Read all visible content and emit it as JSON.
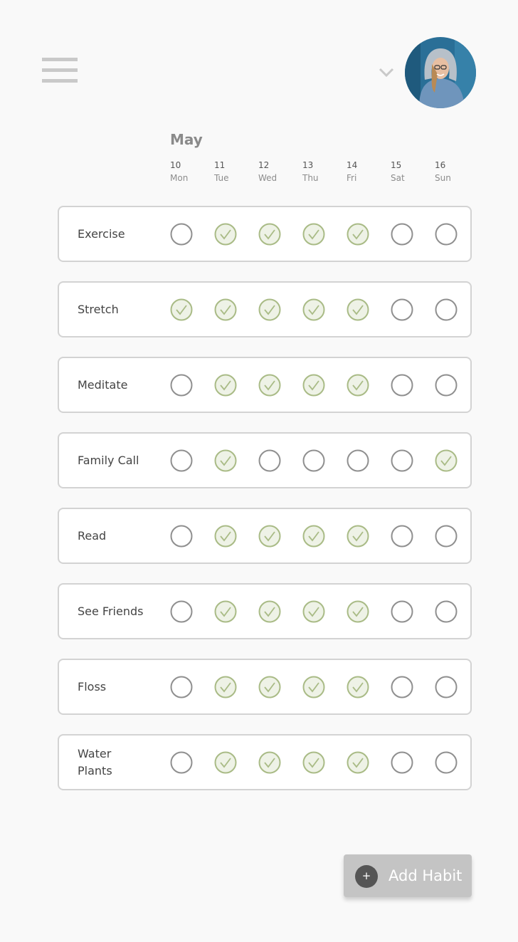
{
  "header": {
    "menu_icon": "hamburger-menu-icon",
    "dropdown_icon": "chevron-down-icon",
    "avatar_icon": "user-avatar"
  },
  "calendar": {
    "month": "May",
    "days": [
      {
        "num": "10",
        "dow": "Mon"
      },
      {
        "num": "11",
        "dow": "Tue"
      },
      {
        "num": "12",
        "dow": "Wed"
      },
      {
        "num": "13",
        "dow": "Thu"
      },
      {
        "num": "14",
        "dow": "Fri"
      },
      {
        "num": "15",
        "dow": "Sat"
      },
      {
        "num": "16",
        "dow": "Sun"
      }
    ]
  },
  "habits": [
    {
      "name": "Exercise",
      "done": [
        false,
        true,
        true,
        true,
        true,
        false,
        false
      ]
    },
    {
      "name": "Stretch",
      "done": [
        true,
        true,
        true,
        true,
        true,
        false,
        false
      ]
    },
    {
      "name": "Meditate",
      "done": [
        false,
        true,
        true,
        true,
        true,
        false,
        false
      ]
    },
    {
      "name": "Family Call",
      "done": [
        false,
        true,
        false,
        false,
        false,
        false,
        true
      ]
    },
    {
      "name": "Read",
      "done": [
        false,
        true,
        true,
        true,
        true,
        false,
        false
      ]
    },
    {
      "name": "See Friends",
      "done": [
        false,
        true,
        true,
        true,
        true,
        false,
        false
      ]
    },
    {
      "name": "Floss",
      "done": [
        false,
        true,
        true,
        true,
        true,
        false,
        false
      ]
    },
    {
      "name": "Water\nPlants",
      "done": [
        false,
        true,
        true,
        true,
        true,
        false,
        false
      ]
    }
  ],
  "add_button": {
    "label": "Add Habit",
    "icon": "plus-icon",
    "plus_symbol": "+"
  },
  "colors": {
    "check_stroke": "#a9bb86",
    "check_fill": "#eef2e6",
    "empty_stroke": "#8f8f8f"
  }
}
